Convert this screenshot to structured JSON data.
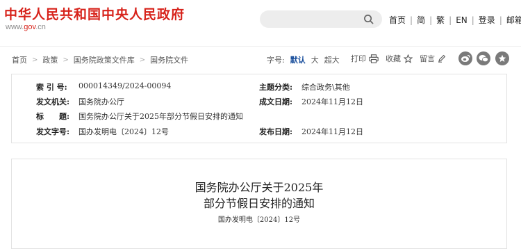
{
  "header": {
    "site_title": "中华人民共和国中央人民政府",
    "site_url_prefix": "www.",
    "site_url_accent": "gov",
    "site_url_suffix": ".cn",
    "nav": [
      "首页",
      "简",
      "繁",
      "EN",
      "登录",
      "邮箱"
    ]
  },
  "breadcrumb": [
    "首页",
    "政策",
    "国务院政策文件库",
    "国务院文件"
  ],
  "font_size": {
    "label": "字号:",
    "options": [
      "默认",
      "大",
      "超大"
    ],
    "active": "默认"
  },
  "tools": {
    "print": "打印",
    "favorite": "收藏",
    "comment": "留言"
  },
  "share_icons": [
    "weibo-icon",
    "wechat-icon",
    "more-share-icon"
  ],
  "info": {
    "index_label": "索 引 号:",
    "index_value": "000014349/2024-00094",
    "topic_label": "主题分类:",
    "topic_value": "综合政务\\其他",
    "issuer_label": "发文机关:",
    "issuer_value": "国务院办公厅",
    "created_label": "成文日期:",
    "created_value": "2024年11月12日",
    "title_label": "标　　题:",
    "title_value": "国务院办公厅关于2025年部分节假日安排的通知",
    "docno_label": "发文字号:",
    "docno_value": "国办发明电〔2024〕12号",
    "published_label": "发布日期:",
    "published_value": "2024年11月12日"
  },
  "document": {
    "title_line1": "国务院办公厅关于2025年",
    "title_line2": "部分节假日安排的通知",
    "doc_number": "国办发明电〔2024〕12号"
  },
  "colors": {
    "brand_red": "#d7231b",
    "link_blue": "#1a4f9c",
    "icon_gray": "#7a7a7a"
  }
}
